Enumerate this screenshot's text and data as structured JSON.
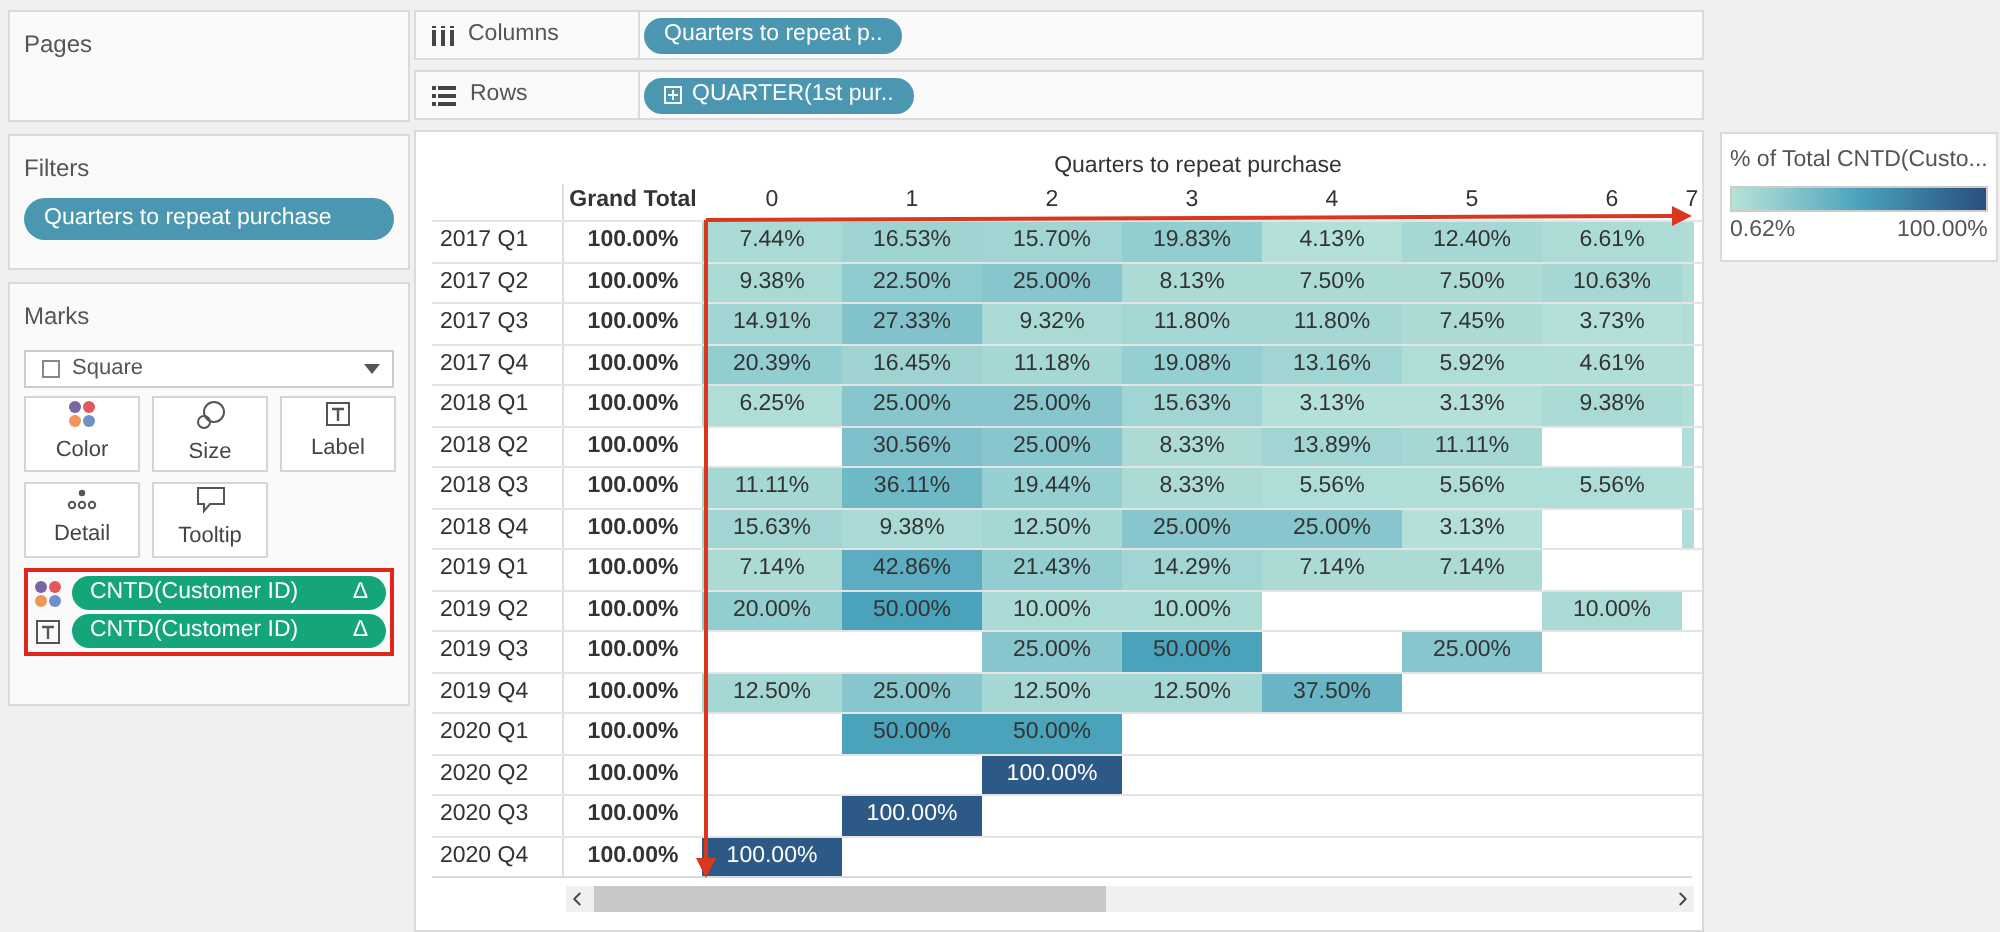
{
  "pages_card": {
    "title": "Pages"
  },
  "filters_card": {
    "title": "Filters",
    "pills": [
      "Quarters to repeat purchase"
    ]
  },
  "marks_card": {
    "title": "Marks",
    "mark_type": "Square",
    "buttons": [
      {
        "kind": "color",
        "label": "Color"
      },
      {
        "kind": "size",
        "label": "Size"
      },
      {
        "kind": "label",
        "label": "Label"
      },
      {
        "kind": "detail",
        "label": "Detail"
      },
      {
        "kind": "tooltip",
        "label": "Tooltip"
      }
    ],
    "fields": [
      {
        "kind": "color",
        "label": "CNTD(Customer ID)",
        "suffix": "Δ"
      },
      {
        "kind": "label",
        "label": "CNTD(Customer ID)",
        "suffix": "Δ"
      }
    ]
  },
  "shelves": [
    {
      "kind": "columns",
      "label": "Columns",
      "pill": "Quarters to repeat p.."
    },
    {
      "kind": "rows",
      "label": "Rows",
      "pill": "QUARTER(1st pur.."
    }
  ],
  "table": {
    "title": "Quarters to repeat purchase",
    "total_header": "Grand Total",
    "columns": [
      "0",
      "1",
      "2",
      "3",
      "4",
      "5",
      "6",
      "7"
    ],
    "rows": [
      {
        "label": "2017 Q1",
        "total": "100.00%",
        "cells": [
          {
            "value": "7.44%",
            "color": "#a9dad5"
          },
          {
            "value": "16.53%",
            "color": "#9ed3d2"
          },
          {
            "value": "15.70%",
            "color": "#a1d5d3"
          },
          {
            "value": "19.83%",
            "color": "#92cdd0"
          },
          {
            "value": "4.13%",
            "color": "#b3e0d9"
          },
          {
            "value": "12.40%",
            "color": "#a5d8d4"
          },
          {
            "value": "6.61%",
            "color": "#addcd6"
          },
          {
            "color": "#afddd7"
          }
        ]
      },
      {
        "label": "2017 Q2",
        "total": "100.00%",
        "cells": [
          {
            "value": "9.38%",
            "color": "#a9dad5"
          },
          {
            "value": "22.50%",
            "color": "#8ecbcf"
          },
          {
            "value": "25.00%",
            "color": "#86c6cc"
          },
          {
            "value": "8.13%",
            "color": "#acdbd6"
          },
          {
            "value": "7.50%",
            "color": "#acdbd6"
          },
          {
            "value": "7.50%",
            "color": "#acdbd6"
          },
          {
            "value": "10.63%",
            "color": "#a5d8d4"
          },
          {
            "color": "#afddd7"
          }
        ]
      },
      {
        "label": "2017 Q3",
        "total": "100.00%",
        "cells": [
          {
            "value": "14.91%",
            "color": "#a1d5d3"
          },
          {
            "value": "27.33%",
            "color": "#82c3cb"
          },
          {
            "value": "9.32%",
            "color": "#a9dad5"
          },
          {
            "value": "11.80%",
            "color": "#a5d8d4"
          },
          {
            "value": "11.80%",
            "color": "#a5d8d4"
          },
          {
            "value": "7.45%",
            "color": "#acdbd6"
          },
          {
            "value": "3.73%",
            "color": "#b3e0d9"
          },
          {
            "color": "#afddd7"
          }
        ]
      },
      {
        "label": "2017 Q4",
        "total": "100.00%",
        "cells": [
          {
            "value": "20.39%",
            "color": "#92cdd0"
          },
          {
            "value": "16.45%",
            "color": "#9ed3d2"
          },
          {
            "value": "11.18%",
            "color": "#a5d8d4"
          },
          {
            "value": "19.08%",
            "color": "#95cfd1"
          },
          {
            "value": "13.16%",
            "color": "#a1d5d3"
          },
          {
            "value": "5.92%",
            "color": "#afddd7"
          },
          {
            "value": "4.61%",
            "color": "#b1dfd8"
          },
          {
            "color": "#afddd7"
          }
        ]
      },
      {
        "label": "2018 Q1",
        "total": "100.00%",
        "cells": [
          {
            "value": "6.25%",
            "color": "#afddd7"
          },
          {
            "value": "25.00%",
            "color": "#86c6cc"
          },
          {
            "value": "25.00%",
            "color": "#86c6cc"
          },
          {
            "value": "15.63%",
            "color": "#a1d5d3"
          },
          {
            "value": "3.13%",
            "color": "#b3e0d9"
          },
          {
            "value": "3.13%",
            "color": "#b3e0d9"
          },
          {
            "value": "9.38%",
            "color": "#a9dad5"
          },
          {
            "color": "#afddd7"
          }
        ]
      },
      {
        "label": "2018 Q2",
        "total": "100.00%",
        "cells": [
          null,
          {
            "value": "30.56%",
            "color": "#7dc0c9"
          },
          {
            "value": "25.00%",
            "color": "#86c6cc"
          },
          {
            "value": "8.33%",
            "color": "#acdbd6"
          },
          {
            "value": "13.89%",
            "color": "#a1d5d3"
          },
          {
            "value": "11.11%",
            "color": "#a5d8d4"
          },
          null,
          {
            "color": "#afddd7"
          }
        ]
      },
      {
        "label": "2018 Q3",
        "total": "100.00%",
        "cells": [
          {
            "value": "11.11%",
            "color": "#a5d8d4"
          },
          {
            "value": "36.11%",
            "color": "#6eb9c6"
          },
          {
            "value": "19.44%",
            "color": "#95cfd1"
          },
          {
            "value": "8.33%",
            "color": "#acdbd6"
          },
          {
            "value": "5.56%",
            "color": "#afddd7"
          },
          {
            "value": "5.56%",
            "color": "#afddd7"
          },
          {
            "value": "5.56%",
            "color": "#afddd7"
          },
          {
            "color": "#afddd7"
          }
        ]
      },
      {
        "label": "2018 Q4",
        "total": "100.00%",
        "cells": [
          {
            "value": "15.63%",
            "color": "#a1d5d3"
          },
          {
            "value": "9.38%",
            "color": "#a9dad5"
          },
          {
            "value": "12.50%",
            "color": "#a5d8d4"
          },
          {
            "value": "25.00%",
            "color": "#86c6cc"
          },
          {
            "value": "25.00%",
            "color": "#86c6cc"
          },
          {
            "value": "3.13%",
            "color": "#b3e0d9"
          },
          null,
          {
            "color": "#afddd7"
          }
        ]
      },
      {
        "label": "2019 Q1",
        "total": "100.00%",
        "cells": [
          {
            "value": "7.14%",
            "color": "#acdbd6"
          },
          {
            "value": "42.86%",
            "color": "#5cadc1"
          },
          {
            "value": "21.43%",
            "color": "#92cdd0"
          },
          {
            "value": "14.29%",
            "color": "#a1d5d3"
          },
          {
            "value": "7.14%",
            "color": "#acdbd6"
          },
          {
            "value": "7.14%",
            "color": "#acdbd6"
          },
          null,
          null
        ]
      },
      {
        "label": "2019 Q2",
        "total": "100.00%",
        "cells": [
          {
            "value": "20.00%",
            "color": "#92cdd0"
          },
          {
            "value": "50.00%",
            "color": "#4aa3bb"
          },
          {
            "value": "10.00%",
            "color": "#a9dad5"
          },
          {
            "value": "10.00%",
            "color": "#a9dad5"
          },
          null,
          null,
          {
            "value": "10.00%",
            "color": "#a9dad5"
          },
          null
        ]
      },
      {
        "label": "2019 Q3",
        "total": "100.00%",
        "cells": [
          null,
          null,
          {
            "value": "25.00%",
            "color": "#86c6cc"
          },
          {
            "value": "50.00%",
            "color": "#4aa3bb"
          },
          null,
          {
            "value": "25.00%",
            "color": "#86c6cc"
          },
          null,
          null
        ]
      },
      {
        "label": "2019 Q4",
        "total": "100.00%",
        "cells": [
          {
            "value": "12.50%",
            "color": "#a5d8d4"
          },
          {
            "value": "25.00%",
            "color": "#86c6cc"
          },
          {
            "value": "12.50%",
            "color": "#a5d8d4"
          },
          {
            "value": "12.50%",
            "color": "#a5d8d4"
          },
          {
            "value": "37.50%",
            "color": "#69b5c5"
          },
          null,
          null,
          null
        ]
      },
      {
        "label": "2020 Q1",
        "total": "100.00%",
        "cells": [
          null,
          {
            "value": "50.00%",
            "color": "#4aa3bb"
          },
          {
            "value": "50.00%",
            "color": "#4aa3bb"
          },
          null,
          null,
          null,
          null,
          null
        ]
      },
      {
        "label": "2020 Q2",
        "total": "100.00%",
        "cells": [
          null,
          null,
          {
            "value": "100.00%",
            "color": "#2c5985"
          },
          null,
          null,
          null,
          null,
          null
        ]
      },
      {
        "label": "2020 Q3",
        "total": "100.00%",
        "cells": [
          null,
          {
            "value": "100.00%",
            "color": "#2c5985"
          },
          null,
          null,
          null,
          null,
          null,
          null
        ]
      },
      {
        "label": "2020 Q4",
        "total": "100.00%",
        "cells": [
          {
            "value": "100.00%",
            "color": "#2c5985"
          },
          null,
          null,
          null,
          null,
          null,
          null,
          null
        ]
      }
    ]
  },
  "legend": {
    "title": "% of Total CNTD(Custo...",
    "min": "0.62%",
    "max": "100.00%"
  }
}
